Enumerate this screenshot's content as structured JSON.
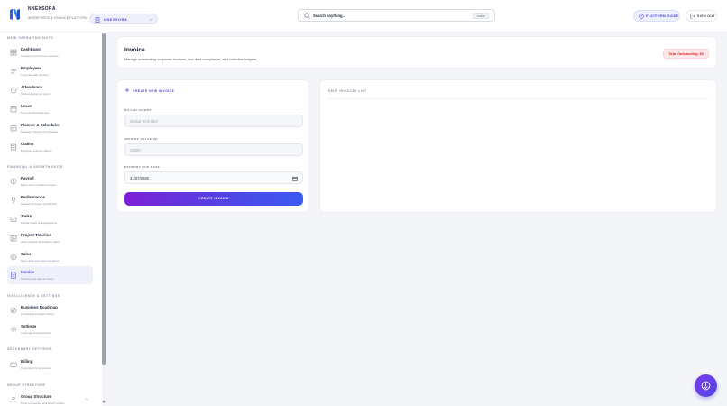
{
  "brand": {
    "name": "NNEXSORA",
    "subtitle": "WORKFORCE & FINANCE PLATFORM",
    "accent": "#4f46e5"
  },
  "org_selector": {
    "label": "NNEXSORA"
  },
  "search": {
    "placeholder": "Search anything...",
    "shortcut": "CMD K"
  },
  "header_actions": {
    "guide_label": "PLATFORM GUIDE",
    "signout_label": "SIGN OUT"
  },
  "sidebar": {
    "sections": [
      {
        "title": "MAIN OPERATING SUITE",
        "items": [
          {
            "label": "Dashboard",
            "sub": "Company performance overview",
            "icon": "grid-icon"
          },
          {
            "label": "Employees",
            "sub": "Corporate staff directory",
            "icon": "users-icon"
          },
          {
            "label": "Attendance",
            "sub": "Verified geofenced logins",
            "icon": "clock-icon"
          },
          {
            "label": "Leave",
            "sub": "Time-off scheduling logs",
            "icon": "calendar-icon"
          },
          {
            "label": "Planner & Scheduler",
            "sub": "Meetings, activities & schedules",
            "icon": "planner-icon"
          },
          {
            "label": "Claims",
            "sub": "Employee expense claims",
            "icon": "receipt-icon"
          }
        ]
      },
      {
        "title": "FINANCIAL & GROWTH SUITE",
        "items": [
          {
            "label": "Payroll",
            "sub": "Salary and compliance ledgers",
            "icon": "payroll-icon"
          },
          {
            "label": "Performance",
            "sub": "Reviews and team growth tools",
            "icon": "trophy-icon"
          },
          {
            "label": "Tasks",
            "sub": "Kanban board & assigned work",
            "icon": "tasks-icon"
          },
          {
            "label": "Project Timeline",
            "sub": "Gantt progress and delivery dates",
            "icon": "timeline-icon"
          },
          {
            "label": "Sales",
            "sub": "Sales deals and customer values",
            "icon": "sales-icon"
          },
          {
            "label": "Invoice",
            "sub": "Invoicing and payment flows",
            "icon": "invoice-icon",
            "active": true
          }
        ]
      },
      {
        "title": "INTELLIGENCE & SETTINGS",
        "items": [
          {
            "label": "Business Roadmap",
            "sub": "Forecasting & targets setting",
            "icon": "roadmap-icon"
          },
          {
            "label": "Settings",
            "sub": "Corporate threshold limits",
            "icon": "gear-icon"
          }
        ]
      },
      {
        "title": "SECONDARY SETTINGS",
        "items": [
          {
            "label": "Billing",
            "sub": "Corporate pricing licenses",
            "icon": "billing-icon"
          }
        ]
      },
      {
        "title": "GROUP STRUCTURE",
        "items": [
          {
            "label": "Group Structure",
            "sub": "Parent companies and branch entities",
            "icon": "group-icon"
          }
        ]
      }
    ]
  },
  "page": {
    "title": "Invoice",
    "subtitle": "Manage outstanding corporate invoices, due-date compliance, and collection ledgers.",
    "outstanding": "Total Outstanding: $0",
    "outstanding_color": "#dc2626"
  },
  "form": {
    "heading": "CREATE NEW INVOICE",
    "client_label": "BILLED CLIENT",
    "client_placeholder": "Global Tech Bhd",
    "value_label": "INVOICE VALUE ($)",
    "value_placeholder": "15000",
    "due_label": "PAYMENT DUE DATE",
    "due_value": "31/07/2026",
    "submit_label": "CREATE INVOICE"
  },
  "list": {
    "heading": "SENT INVOICES LIST"
  }
}
